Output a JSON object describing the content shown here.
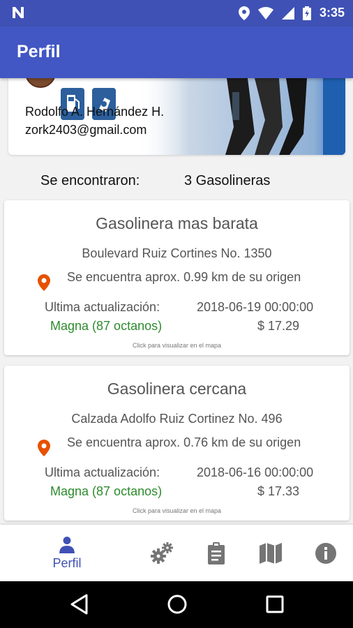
{
  "status_bar": {
    "time": "3:35",
    "icons": [
      "n-logo-icon",
      "location-icon",
      "wifi-icon",
      "signal-icon",
      "battery-icon"
    ]
  },
  "app_bar": {
    "title": "Perfil"
  },
  "profile": {
    "name": "Rodolfo A. Hernández H.",
    "email": "zork2403@gmail.com"
  },
  "results": {
    "label": "Se encontraron:",
    "count": "3 Gasolineras"
  },
  "stations": [
    {
      "title": "Gasolinera mas barata",
      "address": "Boulevard Ruiz Cortines No. 1350",
      "distance": "Se encuentra aprox. 0.99 km de su origen",
      "updated_label": "Ultima actualización:",
      "updated_value": "2018-06-19 00:00:00",
      "fuel": "Magna (87 octanos)",
      "price": "$ 17.29",
      "hint": "Click para visualizar en el mapa"
    },
    {
      "title": "Gasolinera cercana",
      "address": "Calzada Adolfo Ruiz Cortinez No. 496",
      "distance": "Se encuentra aprox. 0.76 km de su origen",
      "updated_label": "Ultima actualización:",
      "updated_value": "2018-06-16 00:00:00",
      "fuel": "Magna (87 octanos)",
      "price": "$ 17.33",
      "hint": "Click para visualizar en el mapa"
    }
  ],
  "bottom_nav": {
    "items": [
      {
        "label": "Perfil",
        "icon": "person-icon",
        "active": true
      },
      {
        "label": "",
        "icon": "gears-icon"
      },
      {
        "label": "",
        "icon": "clipboard-icon"
      },
      {
        "label": "",
        "icon": "map-icon"
      },
      {
        "label": "",
        "icon": "info-icon"
      }
    ]
  },
  "colors": {
    "primary": "#3f51b5",
    "fuel_green": "#2e8b2e",
    "pin_orange": "#e65100"
  }
}
